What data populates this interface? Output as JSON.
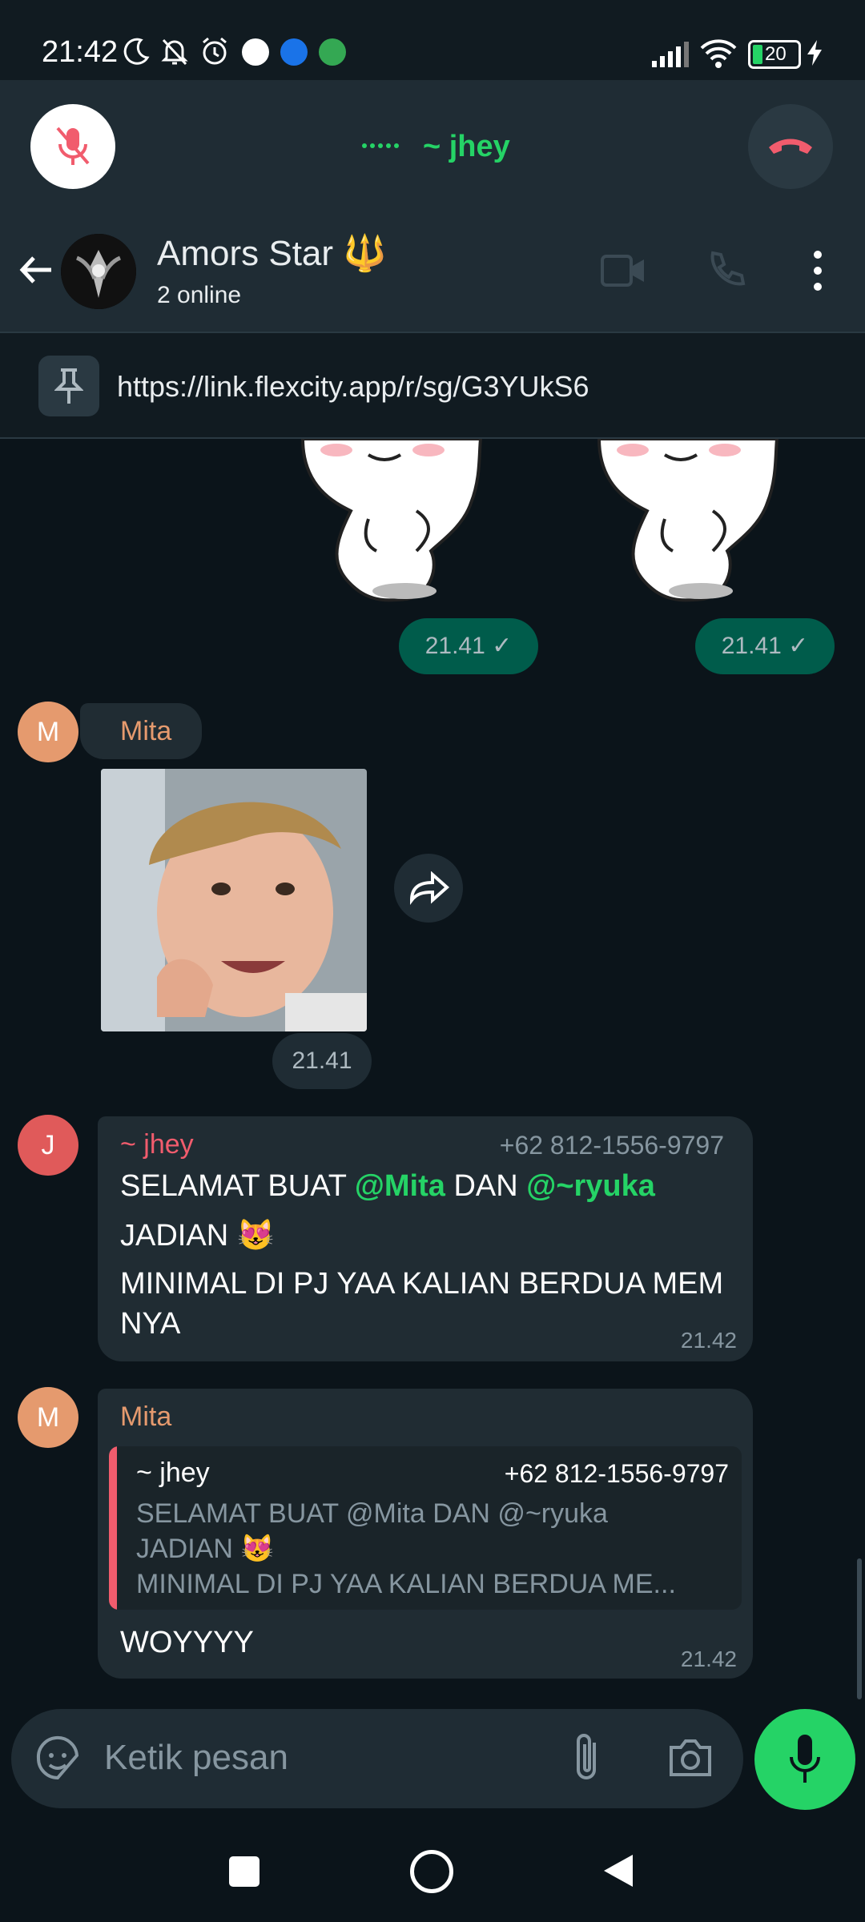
{
  "status_bar": {
    "time": "21:42",
    "battery": "20"
  },
  "call": {
    "name": "~ jhey"
  },
  "header": {
    "title": "Amors Star 🔱",
    "subtitle": "2 online"
  },
  "pinned": {
    "text": "https://link.flexcity.app/r/sg/G3YUkS6"
  },
  "messages": {
    "sticker_time_1": "21.41",
    "sticker_time_2": "21.41",
    "mita_name": "Mita",
    "mita_initial": "M",
    "photo_time": "21.41",
    "jhey_initial": "J",
    "jhey_name": "~ jhey",
    "jhey_phone": "+62 812-1556-9797",
    "jhey_line1_a": "SELAMAT BUAT ",
    "jhey_mention1": "@Mita",
    "jhey_line1_b": "  DAN ",
    "jhey_mention2": "@~ryuka",
    "jhey_line2": "JADIAN 😻",
    "jhey_line3": "MINIMAL DI PJ YAA KALIAN BERDUA MEM NYA",
    "jhey_time": "21.42",
    "reply_name": "Mita",
    "reply_initial": "M",
    "quote_name": "~ jhey",
    "quote_phone": "+62 812-1556-9797",
    "quote_line1": "SELAMAT BUAT @Mita  DAN @~ryuka",
    "quote_line2": "JADIAN 😻",
    "quote_line3": "MINIMAL DI PJ YAA KALIAN BERDUA ME...",
    "reply_text": "WOYYYY",
    "reply_time": "21.42"
  },
  "input": {
    "placeholder": "Ketik pesan"
  },
  "colors": {
    "accent": "#25d366",
    "outgoing": "#005c4b",
    "incoming": "#202c33",
    "end_call": "#f15c6d"
  }
}
